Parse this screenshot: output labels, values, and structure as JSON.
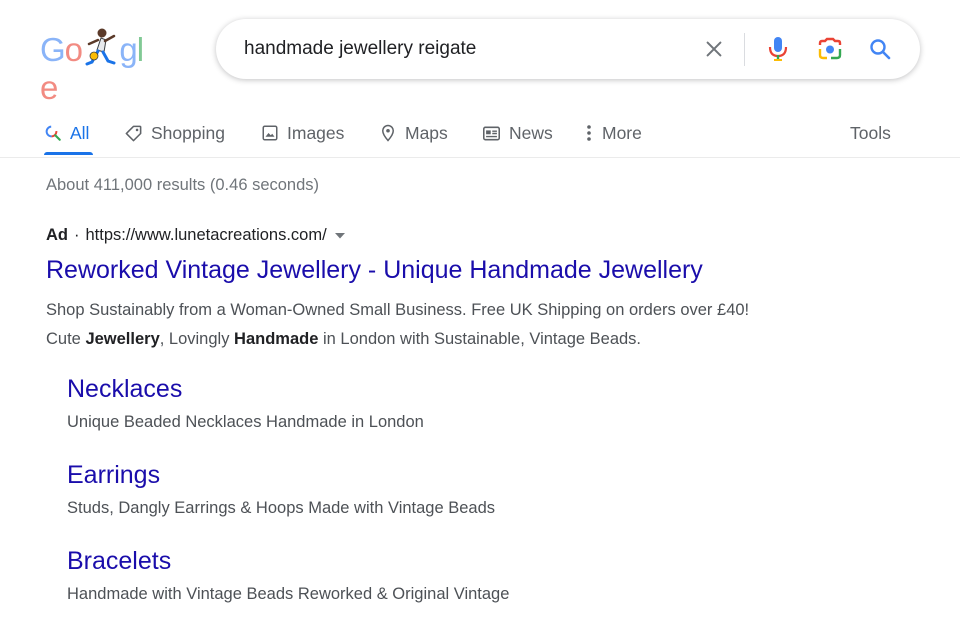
{
  "logo": {
    "letters": [
      "G",
      "o",
      "o",
      "g",
      "l",
      "e"
    ],
    "colors": [
      "#4285f4",
      "#ea4335",
      "#fbbc05",
      "#4285f4",
      "#34a853",
      "#ea4335"
    ]
  },
  "search": {
    "query": "handmade jewellery reigate",
    "icons": [
      "close-icon",
      "microphone-icon",
      "lens-camera-icon",
      "search-icon"
    ]
  },
  "tabs": [
    {
      "label": "All",
      "icon": "search-icon",
      "active": true
    },
    {
      "label": "Shopping",
      "icon": "tag-icon"
    },
    {
      "label": "Images",
      "icon": "image-icon"
    },
    {
      "label": "Maps",
      "icon": "map-pin-icon"
    },
    {
      "label": "News",
      "icon": "newspaper-icon"
    },
    {
      "label": "More",
      "icon": "more-vert-icon"
    },
    {
      "label": "Tools"
    }
  ],
  "stats": "About 411,000 results (0.46 seconds)",
  "ad": {
    "label": "Ad",
    "separator": "·",
    "url": "https://www.lunetacreations.com/",
    "title": "Reworked Vintage Jewellery - Unique Handmade Jewellery",
    "desc_line1": "Shop Sustainably from a Woman-Owned Small Business. Free UK Shipping on orders over £40!",
    "desc_line2": {
      "p1": "Cute ",
      "b1": "Jewellery",
      "p2": ", Lovingly ",
      "b2": "Handmade",
      "p3": " in London with Sustainable, Vintage Beads."
    }
  },
  "sitelinks": [
    {
      "title": "Necklaces",
      "desc": "Unique Beaded Necklaces Handmade in London"
    },
    {
      "title": "Earrings",
      "desc": "Studs, Dangly Earrings & Hoops Made with Vintage Beads"
    },
    {
      "title": "Bracelets",
      "desc": "Handmade with Vintage Beads Reworked & Original Vintage"
    }
  ],
  "colors": {
    "link": "#1a0dab",
    "accent": "#1a73e8",
    "muted": "#70757a"
  }
}
